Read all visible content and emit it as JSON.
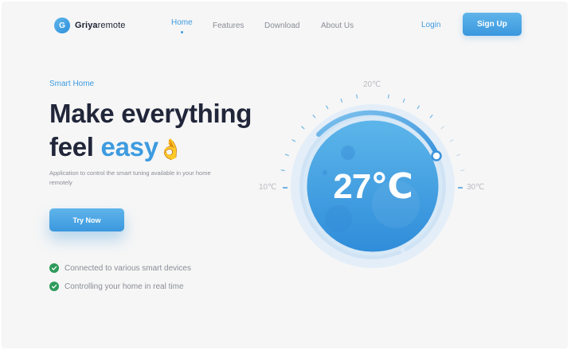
{
  "brand": {
    "mark": "G",
    "name_bold": "Griya",
    "name_light": "remote"
  },
  "nav": {
    "items": [
      {
        "label": "Home",
        "active": true
      },
      {
        "label": "Features",
        "active": false
      },
      {
        "label": "Download",
        "active": false
      },
      {
        "label": "About Us",
        "active": false
      }
    ],
    "login": "Login",
    "signup": "Sign Up"
  },
  "hero": {
    "eyebrow": "Smart Home",
    "headline_line1": "Make everything",
    "headline_line2_plain": "feel ",
    "headline_line2_accent": "easy",
    "headline_emoji": "👌",
    "description": "Application to control the smart tuning available in your home remotely",
    "cta": "Try Now",
    "features": [
      "Connected to various smart devices",
      "Controlling your home in real time"
    ]
  },
  "thermostat": {
    "current": "27℃",
    "scale_top": "20℃",
    "scale_left": "10℃",
    "scale_right": "30℃"
  },
  "colors": {
    "accent": "#3d9be0",
    "text_dark": "#21263a",
    "text_muted": "#8a8d97",
    "check_green": "#2e9a5b",
    "background": "#f6f6f6"
  },
  "icons": [
    "check-circle-icon",
    "logo-mark-icon",
    "active-dot-icon"
  ]
}
